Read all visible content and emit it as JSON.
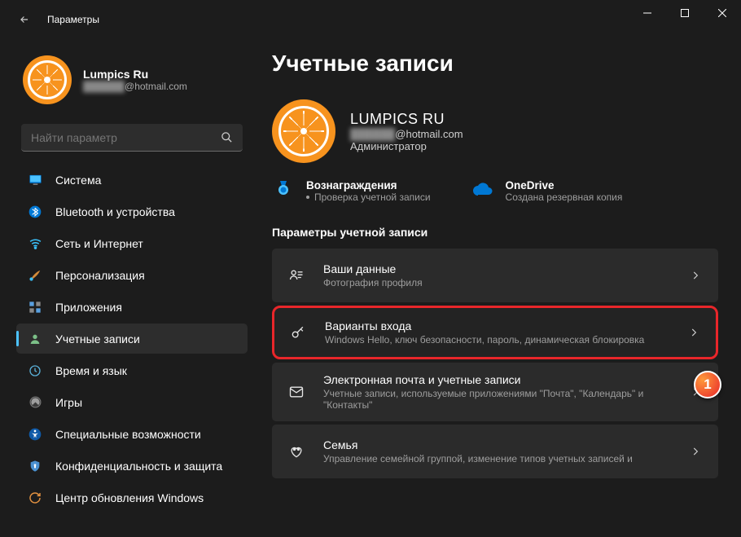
{
  "window": {
    "title": "Параметры"
  },
  "profile": {
    "name": "Lumpics Ru",
    "email_hidden": "██████",
    "email_domain": "@hotmail.com"
  },
  "search": {
    "placeholder": "Найти параметр"
  },
  "nav": [
    {
      "id": "system",
      "label": "Система"
    },
    {
      "id": "bluetooth",
      "label": "Bluetooth и устройства"
    },
    {
      "id": "network",
      "label": "Сеть и Интернет"
    },
    {
      "id": "personalization",
      "label": "Персонализация"
    },
    {
      "id": "apps",
      "label": "Приложения"
    },
    {
      "id": "accounts",
      "label": "Учетные записи"
    },
    {
      "id": "time",
      "label": "Время и язык"
    },
    {
      "id": "gaming",
      "label": "Игры"
    },
    {
      "id": "accessibility",
      "label": "Специальные возможности"
    },
    {
      "id": "privacy",
      "label": "Конфиденциальность и защита"
    },
    {
      "id": "update",
      "label": "Центр обновления Windows"
    }
  ],
  "page": {
    "title": "Учетные записи",
    "account_name": "LUMPICS RU",
    "account_email_hidden": "██████",
    "account_email_domain": "@hotmail.com",
    "account_role": "Администратор",
    "tiles": {
      "rewards_title": "Вознаграждения",
      "rewards_sub": "Проверка учетной записи",
      "onedrive_title": "OneDrive",
      "onedrive_sub": "Создана резервная копия"
    },
    "section_label": "Параметры учетной записи",
    "cards": [
      {
        "title": "Ваши данные",
        "sub": "Фотография профиля"
      },
      {
        "title": "Варианты входа",
        "sub": "Windows Hello, ключ безопасности, пароль, динамическая блокировка"
      },
      {
        "title": "Электронная почта и учетные записи",
        "sub": "Учетные записи, используемые приложениями \"Почта\", \"Календарь\" и \"Контакты\""
      },
      {
        "title": "Семья",
        "sub": "Управление семейной группой, изменение типов учетных записей и"
      }
    ]
  },
  "callout": "1"
}
